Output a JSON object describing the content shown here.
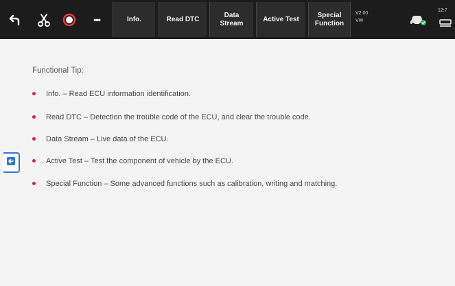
{
  "toolbar": {
    "icons": [
      "back-icon",
      "scissors-icon",
      "record-icon",
      "more-icon"
    ],
    "more_glyph": "•••"
  },
  "tabs": [
    {
      "label": "Info."
    },
    {
      "label": "Read DTC"
    },
    {
      "label": "Data Stream"
    },
    {
      "label": "Active Test"
    },
    {
      "label": "Special Function"
    }
  ],
  "status": {
    "version": "V2.00",
    "make": "VW",
    "time": "12:7",
    "vehicle_icon": "car-connected-icon",
    "vci_icon": "vci-link-icon"
  },
  "main": {
    "tip_title": "Functional Tip:",
    "items": [
      "Info. – Read ECU information identification.",
      "Read DTC – Detection the trouble code of the ECU, and clear the trouble code.",
      "Data Stream – Live data of the ECU.",
      "Active Test – Test the component of vehicle by the ECU.",
      "Special Function – Some advanced functions such as calibration, writing and matching."
    ]
  },
  "side": {
    "icon": "exit-arrow-icon"
  },
  "colors": {
    "bar": "#1c1c1c",
    "tab": "#2c2c2c",
    "bullet": "#d42a2a",
    "accent": "#2d78d6",
    "background": "#f4f4f4"
  }
}
